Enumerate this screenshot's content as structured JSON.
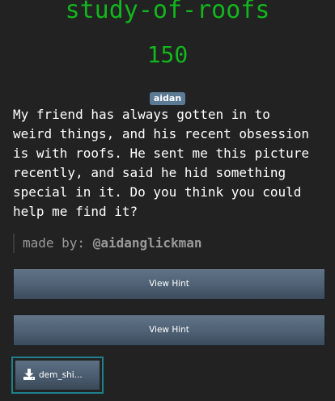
{
  "challenge": {
    "title": "study-of-roofs",
    "points": "150",
    "tag": "aidan",
    "description_lines": [
      "My friend has always gotten in to",
      "weird things, and his recent obsession",
      "is with roofs. He sent me this picture",
      "recently, and said he hid something",
      "special in it. Do you think you could",
      "help me find it?"
    ],
    "author_prefix": "made by: ",
    "author_handle": "@aidanglickman"
  },
  "hints": [
    {
      "label": "View Hint"
    },
    {
      "label": "View Hint"
    }
  ],
  "file": {
    "name": "dem_shi...",
    "icon": "download-icon"
  },
  "colors": {
    "background": "#222222",
    "title_green": "#11b71d",
    "tag_bg": "#5b7a94",
    "button_mid": "#4e6073",
    "file_border": "#1f7f8c"
  }
}
